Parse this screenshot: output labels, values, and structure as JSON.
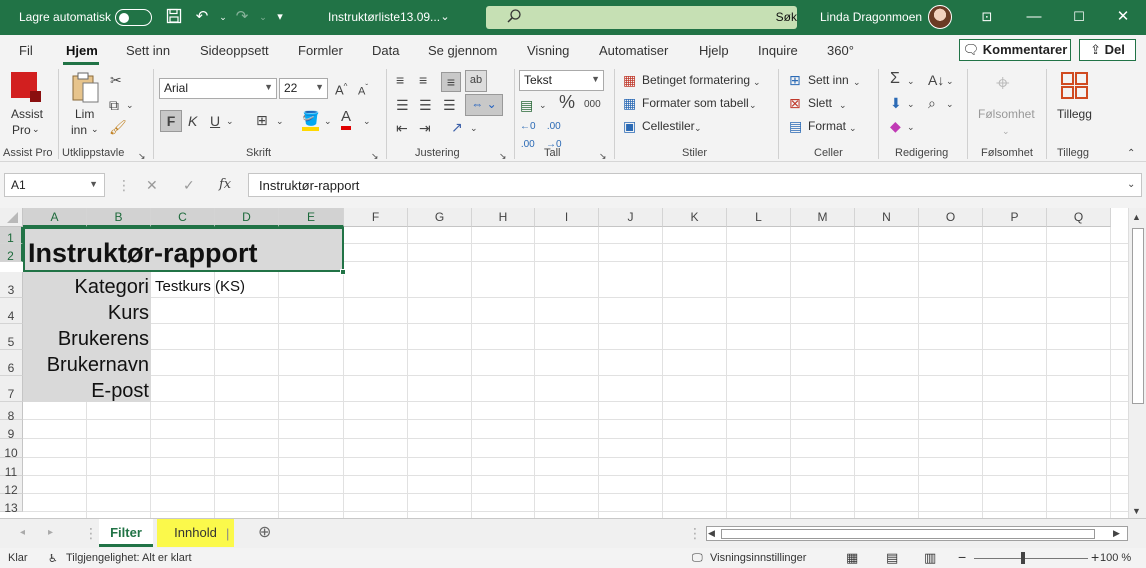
{
  "titlebar": {
    "autosave_label": "Lagre automatisk",
    "filename": "Instruktørliste13.09...",
    "search_label": "Søk",
    "user_name": "Linda Dragonmoen"
  },
  "tabs": [
    {
      "label": "Fil"
    },
    {
      "label": "Hjem"
    },
    {
      "label": "Sett inn"
    },
    {
      "label": "Sideoppsett"
    },
    {
      "label": "Formler"
    },
    {
      "label": "Data"
    },
    {
      "label": "Se gjennom"
    },
    {
      "label": "Visning"
    },
    {
      "label": "Automatiser"
    },
    {
      "label": "Hjelp"
    },
    {
      "label": "Inquire"
    },
    {
      "label": "360°"
    }
  ],
  "tab_actions": {
    "comments": "Kommentarer",
    "share": "Del"
  },
  "ribbon": {
    "assist_pro": {
      "label_line1": "Assist",
      "label_line2": "Pro",
      "group": "Assist Pro"
    },
    "clipboard": {
      "paste_line1": "Lim",
      "paste_line2": "inn",
      "group": "Utklippstavle"
    },
    "font": {
      "name": "Arial",
      "size": "22",
      "bold": "F",
      "italic": "K",
      "underline": "U",
      "group": "Skrift"
    },
    "alignment": {
      "group": "Justering"
    },
    "number": {
      "format": "Tekst",
      "group": "Tall",
      "thousands": "000"
    },
    "styles": {
      "conditional": "Betinget formatering",
      "as_table": "Formater som tabell",
      "cell_styles": "Cellestiler",
      "group": "Stiler"
    },
    "cells": {
      "insert": "Sett inn",
      "delete": "Slett",
      "format": "Format",
      "group": "Celler"
    },
    "editing": {
      "group": "Redigering"
    },
    "sensitivity": {
      "label": "Følsomhet",
      "group": "Følsomhet"
    },
    "addins": {
      "label": "Tillegg",
      "group": "Tillegg"
    }
  },
  "formula_bar": {
    "name_box": "A1",
    "content": "Instruktør-rapport"
  },
  "grid": {
    "columns": [
      "A",
      "B",
      "C",
      "D",
      "E",
      "F",
      "G",
      "H",
      "I",
      "J",
      "K",
      "L",
      "M",
      "N",
      "O",
      "P",
      "Q"
    ],
    "rows": [
      "1",
      "2",
      "3",
      "4",
      "5",
      "6",
      "7",
      "8",
      "9",
      "10",
      "11",
      "12",
      "13"
    ],
    "title": "Instruktør-rapport",
    "labels": [
      "Kategori",
      "Kurs",
      "Brukerens",
      "Brukernavn",
      "E-post"
    ],
    "c3_value": "Testkurs (KS)"
  },
  "sheets": [
    {
      "name": "Filter"
    },
    {
      "name": "Innhold"
    }
  ],
  "status": {
    "ready": "Klar",
    "accessibility": "Tilgjengelighet: Alt er klart",
    "view_settings": "Visningsinnstillinger",
    "zoom": "100 %"
  },
  "colors": {
    "brand": "#217346",
    "highlight": "#fbf94b"
  }
}
